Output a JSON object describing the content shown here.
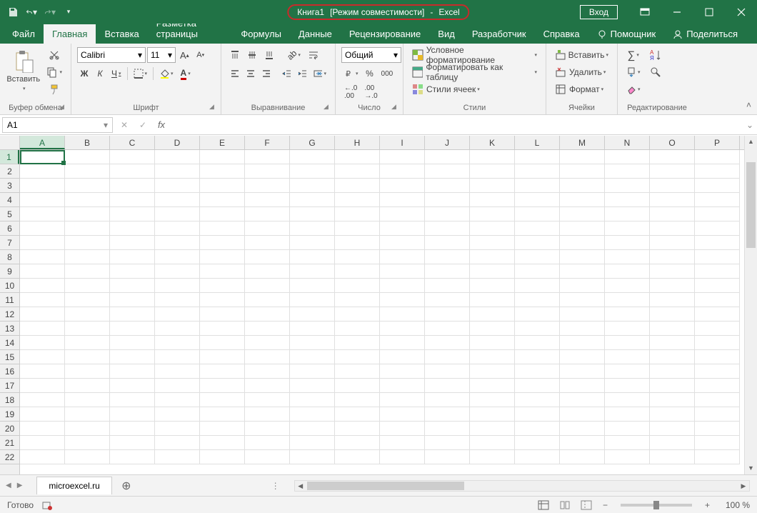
{
  "title": {
    "doc": "Книга1",
    "mode": "[Режим совместимости]",
    "app": "Excel",
    "login": "Вход"
  },
  "tabs": [
    "Файл",
    "Главная",
    "Вставка",
    "Разметка страницы",
    "Формулы",
    "Данные",
    "Рецензирование",
    "Вид",
    "Разработчик",
    "Справка"
  ],
  "tabs_right": {
    "helper": "Помощник",
    "share": "Поделиться"
  },
  "active_tab": 1,
  "ribbon": {
    "clipboard": {
      "label": "Буфер обмена",
      "paste": "Вставить"
    },
    "font": {
      "label": "Шрифт",
      "name": "Calibri",
      "size": "11",
      "bold": "Ж",
      "italic": "К",
      "underline": "Ч"
    },
    "align": {
      "label": "Выравнивание"
    },
    "number": {
      "label": "Число",
      "format": "Общий",
      "percent": "%",
      "comma": "000"
    },
    "styles": {
      "label": "Стили",
      "cond": "Условное форматирование",
      "table": "Форматировать как таблицу",
      "cell": "Стили ячеек"
    },
    "cells": {
      "label": "Ячейки",
      "insert": "Вставить",
      "delete": "Удалить",
      "format": "Формат"
    },
    "editing": {
      "label": "Редактирование"
    }
  },
  "formula": {
    "cell_ref": "A1"
  },
  "columns": [
    "A",
    "B",
    "C",
    "D",
    "E",
    "F",
    "G",
    "H",
    "I",
    "J",
    "K",
    "L",
    "M",
    "N",
    "O",
    "P"
  ],
  "rows": [
    1,
    2,
    3,
    4,
    5,
    6,
    7,
    8,
    9,
    10,
    11,
    12,
    13,
    14,
    15,
    16,
    17,
    18,
    19,
    20,
    21,
    22
  ],
  "sheet": {
    "name": "microexcel.ru"
  },
  "status": {
    "ready": "Готово",
    "zoom": "100 %"
  }
}
